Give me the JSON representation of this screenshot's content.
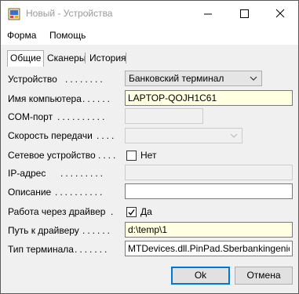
{
  "window": {
    "title": "Новый - Устройства"
  },
  "menu": {
    "items": [
      "Форма",
      "Помощь"
    ]
  },
  "tabs": [
    "Общие",
    "Сканеры",
    "История"
  ],
  "form": {
    "device": {
      "label": "Устройство",
      "value": "Банковский терминал"
    },
    "computer_name": {
      "label": "Имя компьютера",
      "value": "LAPTOP-QOJH1C61"
    },
    "com_port": {
      "label": "COM-порт",
      "value": ""
    },
    "baud_rate": {
      "label": "Скорость передачи",
      "value": ""
    },
    "network_device": {
      "label": "Сетевое устройство",
      "checked": false,
      "check_label": "Нет"
    },
    "ip_address": {
      "label": "IP-адрес",
      "value": ""
    },
    "description": {
      "label": "Описание",
      "value": ""
    },
    "via_driver": {
      "label": "Работа через драйвер",
      "checked": true,
      "check_label": "Да"
    },
    "driver_path": {
      "label": "Путь к драйверу",
      "value": "d:\\temp\\1"
    },
    "terminal_type": {
      "label": "Тип терминала",
      "value": "MTDevices.dll.PinPad.Sberbankingenico"
    }
  },
  "buttons": {
    "ok": "Ok",
    "cancel": "Отмена"
  },
  "colors": {
    "accent": "#0078d7",
    "highlight_field": "#ffffe1"
  }
}
